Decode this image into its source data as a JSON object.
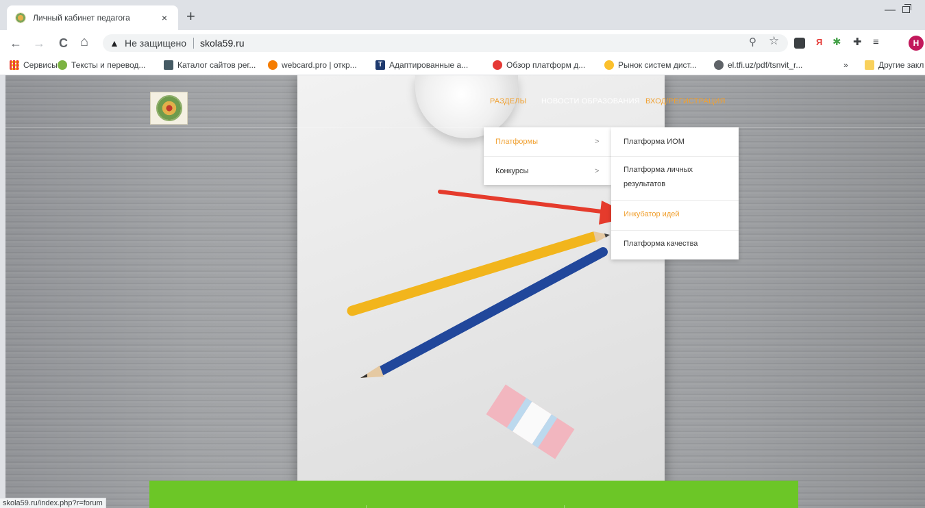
{
  "browser": {
    "tab": {
      "title": "Личный кабинет педагога",
      "close": "×"
    },
    "new_tab": "+",
    "window": {
      "minimize": "—"
    },
    "nav": {
      "back": "←",
      "forward": "→",
      "reload": "C",
      "home": "⌂"
    },
    "security_label": "Не защищено",
    "url": "skola59.ru",
    "profile_initial": "H"
  },
  "bookmarks": [
    {
      "label": "Сервисы",
      "icon": "apps-grid-icon",
      "color": "#f4b400"
    },
    {
      "label": "Тексты и перевод...",
      "icon": "bird-icon",
      "color": "#7cb342"
    },
    {
      "label": "Каталог сайтов рег...",
      "icon": "car-icon",
      "color": "#455a64"
    },
    {
      "label": "webcard.pro | откр...",
      "icon": "webcard-icon",
      "color": "#f57c00"
    },
    {
      "label": "Адаптированные а...",
      "icon": "t-logo-icon",
      "color": "#1e3a6e"
    },
    {
      "label": "Обзор платформ д...",
      "icon": "flower-icon",
      "color": "#e53935"
    },
    {
      "label": "Рынок систем дист...",
      "icon": "coin-icon",
      "color": "#fbc02d"
    },
    {
      "label": "el.tfi.uz/pdf/tsnvit_r...",
      "icon": "globe-icon",
      "color": "#5f6368"
    },
    {
      "label": "»",
      "icon": "",
      "color": ""
    },
    {
      "label": "Другие закл",
      "icon": "folder-icon",
      "color": "#f9d15c"
    }
  ],
  "site": {
    "nav": {
      "razdely": "РАЗДЕЛЫ",
      "news": "НОВОСТИ ОБРАЗОВАНИЯ",
      "login": "ВХОД/РЕГИСТРАЦИЯ"
    },
    "submenu1": [
      {
        "label": "Платформы",
        "chevron": ">"
      },
      {
        "label": "Конкурсы",
        "chevron": ">"
      }
    ],
    "submenu2": [
      {
        "label": "Платформа ИОМ"
      },
      {
        "label": "Платформа личных результатов"
      },
      {
        "label": "Инкубатор идей"
      },
      {
        "label": "Платформа качества"
      }
    ],
    "colors": {
      "accent": "#f0a030",
      "green_bar": "#6cc627",
      "arrow": "#e53b2c"
    }
  },
  "status_url": "skola59.ru/index.php?r=forum"
}
